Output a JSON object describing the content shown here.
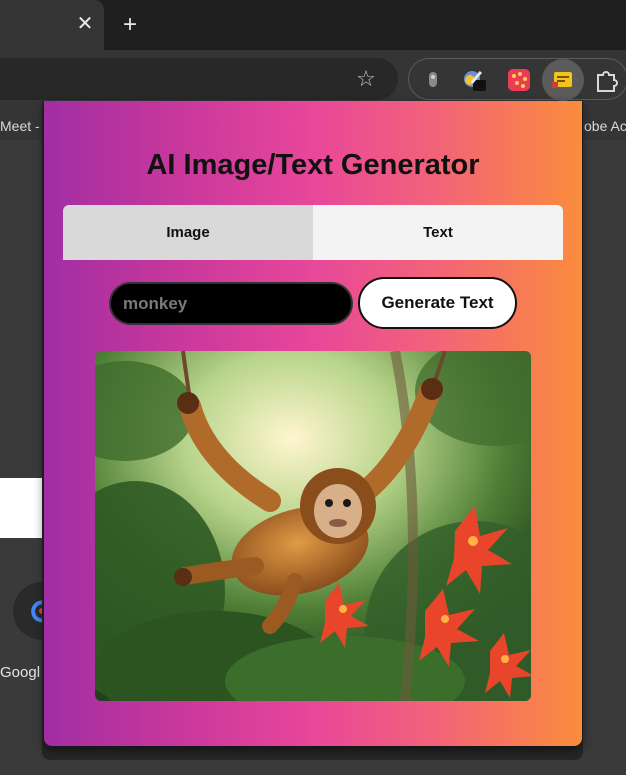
{
  "browser": {
    "tab_close_glyph": "✕",
    "new_tab_glyph": "+",
    "star_glyph": "☆",
    "bookmarks": [
      "Meet -",
      "obe Ac"
    ],
    "page_label": "Googl"
  },
  "extension": {
    "title": "AI Image/Text Generator",
    "tabs": [
      {
        "label": "Image",
        "selected": true
      },
      {
        "label": "Text",
        "selected": false
      }
    ],
    "prompt": {
      "value": "",
      "placeholder": "monkey"
    },
    "generate_label": "Generate Text",
    "result_image": {
      "subject": "monkey swinging from vines in a jungle with red flowers"
    }
  },
  "colors": {
    "gradient_start": "#a12ea3",
    "gradient_mid": "#e8479a",
    "gradient_end": "#fb8c3c"
  }
}
